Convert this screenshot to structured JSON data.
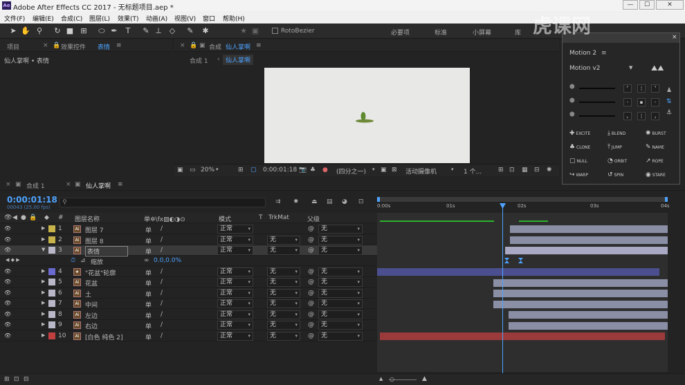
{
  "titlebar": {
    "title": "Adobe After Effects CC 2017 - 无标题项目.aep *",
    "logo": "Ae",
    "min": "—",
    "max": "☐",
    "close": "✕"
  },
  "menu": [
    "文件(F)",
    "编辑(E)",
    "合成(C)",
    "图层(L)",
    "效果(T)",
    "动画(A)",
    "视图(V)",
    "窗口",
    "帮助(H)"
  ],
  "toolbar": {
    "rotobezier": "RotoBezier",
    "workspaces": [
      "必要项",
      "标准",
      "小屏幕",
      "库"
    ]
  },
  "project": {
    "tab": "项目",
    "effects_tab": "效果控件",
    "effects_target": "表情",
    "breadcrumb": "仙人掌啊 • 表情"
  },
  "comp": {
    "tab_prefix": "合成",
    "tab_name": "仙人掌啊",
    "crumb_a": "合成 1",
    "crumb_b": "仙人掌啊",
    "zoom": "20%",
    "timecode": "0:00:01:18",
    "resolution": "(四分之一)",
    "camera": "活动摄像机",
    "view": "1 个..."
  },
  "timeline": {
    "tab1": "合成 1",
    "tab2": "仙人掌啊",
    "timecode": "0:00:01:18",
    "frames": "00043 (25.00 fps)",
    "search_placeholder": "",
    "headers": {
      "num": "#",
      "name": "图层名称",
      "mode": "模式",
      "t": "T",
      "trkmat": "TrkMat",
      "parent": "父级"
    },
    "ruler": [
      "0:00s",
      "01s",
      "02s",
      "03s",
      "04s"
    ],
    "layers": [
      {
        "num": "1",
        "name": "图层 7",
        "color": "#c8b34a",
        "mode": "正常",
        "trk": "",
        "parent": "无",
        "shy": "单"
      },
      {
        "num": "2",
        "name": "图层 8",
        "color": "#c8b34a",
        "mode": "正常",
        "trk": "无",
        "parent": "无",
        "shy": "单"
      },
      {
        "num": "3",
        "name": "表情",
        "color": "#b8b8c8",
        "mode": "正常",
        "trk": "无",
        "parent": "无",
        "shy": "单"
      },
      {
        "num": "4",
        "name": "\"花盆\"轮廓",
        "color": "#6a6ad0",
        "mode": "正常",
        "trk": "无",
        "parent": "无",
        "shy": "单"
      },
      {
        "num": "5",
        "name": "花盆",
        "color": "#b8b8c8",
        "mode": "正常",
        "trk": "无",
        "parent": "无",
        "shy": "单"
      },
      {
        "num": "6",
        "name": "土",
        "color": "#b8b8c8",
        "mode": "正常",
        "trk": "无",
        "parent": "无",
        "shy": "单"
      },
      {
        "num": "7",
        "name": "中间",
        "color": "#b8b8c8",
        "mode": "正常",
        "trk": "无",
        "parent": "无",
        "shy": "单"
      },
      {
        "num": "8",
        "name": "左边",
        "color": "#b8b8c8",
        "mode": "正常",
        "trk": "无",
        "parent": "无",
        "shy": "单"
      },
      {
        "num": "9",
        "name": "右边",
        "color": "#b8b8c8",
        "mode": "正常",
        "trk": "无",
        "parent": "无",
        "shy": "单"
      },
      {
        "num": "10",
        "name": "[白色 纯色 2]",
        "color": "#c04040",
        "mode": "正常",
        "trk": "无",
        "parent": "无",
        "shy": "单"
      }
    ],
    "scale_label": "缩放",
    "scale_value": "0.0,0.0%"
  },
  "motion": {
    "title": "Motion 2",
    "preset": "Motion v2",
    "buttons": [
      "EXCITE",
      "BLEND",
      "BURST",
      "CLONE",
      "JUMP",
      "NAME",
      "NULL",
      "ORBIT",
      "ROPE",
      "WARP",
      "SPIN",
      "STARE"
    ]
  },
  "watermark": "虎课网"
}
